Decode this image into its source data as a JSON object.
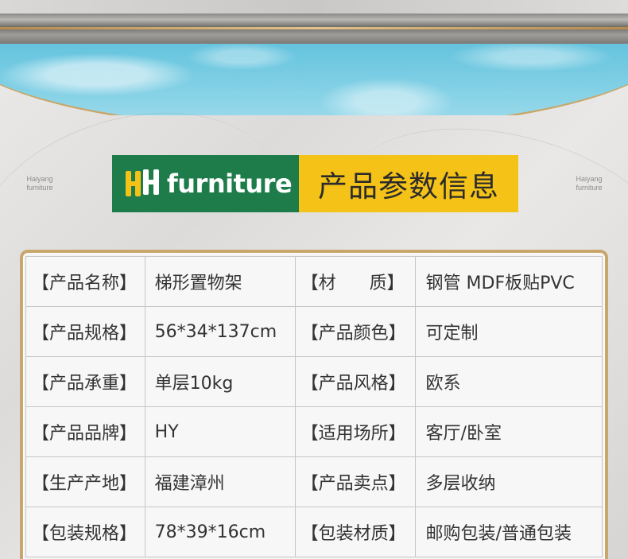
{
  "side_logo": {
    "line1": "Haiyang",
    "line2": "furniture"
  },
  "banner": {
    "brand": "furniture",
    "title": "产品参数信息",
    "brand_color": "#1e7c4b",
    "title_bg": "#f5c317"
  },
  "material_label": {
    "open": "【材",
    "close": "质】"
  },
  "rows": [
    {
      "label1": "【产品名称】",
      "value1": "梯形置物架",
      "label2": null,
      "value2": "钢管 MDF板贴PVC"
    },
    {
      "label1": "【产品规格】",
      "value1": "56*34*137cm",
      "label2": "【产品颜色】",
      "value2": "可定制"
    },
    {
      "label1": "【产品承重】",
      "value1": "单层10kg",
      "label2": "【产品风格】",
      "value2": "欧系"
    },
    {
      "label1": "【产品品牌】",
      "value1": "HY",
      "label2": "【适用场所】",
      "value2": "客厅/卧室"
    },
    {
      "label1": "【生产产地】",
      "value1": "福建漳州",
      "label2": "【产品卖点】",
      "value2": "多层收纳"
    },
    {
      "label1": "【包装规格】",
      "value1": "78*39*16cm",
      "label2": "【包装材质】",
      "value2": "邮购包装/普通包装"
    }
  ]
}
